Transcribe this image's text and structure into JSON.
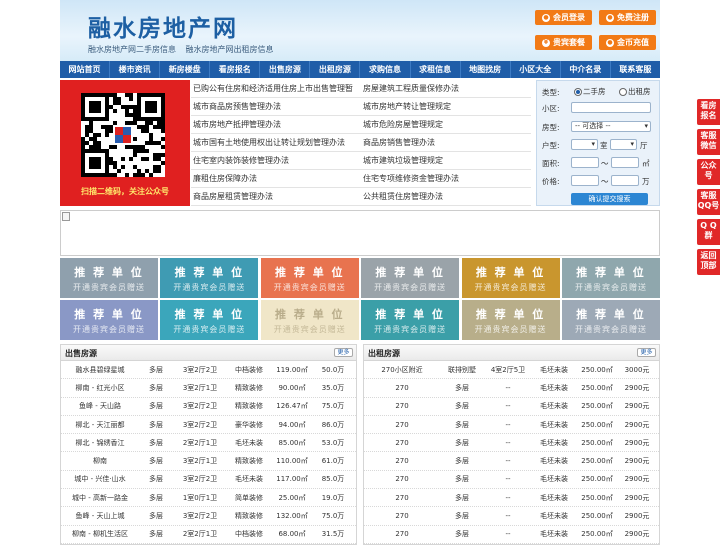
{
  "header": {
    "logo": "融水房地产网",
    "slogans": [
      "融水房地产网二手房信息",
      "融水房地产网出租房信息"
    ],
    "buttons": [
      "会员登录",
      "免费注册",
      "贵宾套餐",
      "金币充值"
    ]
  },
  "nav": [
    "网站首页",
    "楼市资讯",
    "新房楼盘",
    "看房报名",
    "出售房源",
    "出租房源",
    "求购信息",
    "求租信息",
    "地图找房",
    "小区大全",
    "中介名录",
    "联系客服"
  ],
  "qr": {
    "caption": "扫描二维码，关注公众号"
  },
  "news": [
    [
      "已购公有住房和经济适用住房上市出售管理暂",
      "房屋建筑工程质量保修办法"
    ],
    [
      "城市商品房预售管理办法",
      "城市房地产转让管理规定"
    ],
    [
      "城市房地产抵押管理办法",
      "城市危险房屋管理规定"
    ],
    [
      "城市国有土地使用权出让转让规划管理办法",
      "商品房销售管理办法"
    ],
    [
      "住宅室内装饰装修管理办法",
      "城市建筑垃圾管理规定"
    ],
    [
      "廉租住房保障办法",
      "住宅专项维修资金管理办法"
    ],
    [
      "商品房屋租赁管理办法",
      "公共租赁住房管理办法"
    ]
  ],
  "search": {
    "type_label": "类型:",
    "type_options": [
      "二手房",
      "出租房"
    ],
    "community_label": "小区:",
    "house_type_label": "房型:",
    "house_type_value": "-- 可选择 --",
    "layout_label": "户型:",
    "room_unit": "室",
    "hall_unit": "厅",
    "area_label": "面积:",
    "range_sep": "〜",
    "area_unit": "㎡",
    "price_label": "价格:",
    "price_unit": "万",
    "submit": "确认提交搜索"
  },
  "ads": {
    "title": "推 荐 单 位",
    "subtitle": "开通贵宾会员赠送",
    "colors": [
      "#8fa0ad",
      "#3f9bb3",
      "#e8734f",
      "#9aa3a9",
      "#c9962e",
      "#8fa7ad",
      "#8a98c6",
      "#3ba6bb",
      "#f0e6c8",
      "#3b9fa8",
      "#b8ae8a",
      "#9da9b6"
    ]
  },
  "sale": {
    "title": "出售房源",
    "more": "更多",
    "rows": [
      [
        "融水县碧绿星城",
        "多层",
        "3室2厅2卫",
        "中档装修",
        "119.00㎡",
        "50.0万"
      ],
      [
        "柳南 - 红光小区",
        "多层",
        "3室2厅1卫",
        "精致装修",
        "90.00㎡",
        "35.0万"
      ],
      [
        "鱼峰 - 天山路",
        "多层",
        "3室2厅2卫",
        "精致装修",
        "126.47㎡",
        "75.0万"
      ],
      [
        "柳北 - 天江丽都",
        "多层",
        "3室2厅2卫",
        "豪华装修",
        "94.00㎡",
        "86.0万"
      ],
      [
        "柳北 - 锦绣香江",
        "多层",
        "2室2厅1卫",
        "毛坯未装",
        "85.00㎡",
        "53.0万"
      ],
      [
        "柳南",
        "多层",
        "3室2厅1卫",
        "精致装修",
        "110.00㎡",
        "61.0万"
      ],
      [
        "城中 - 兴佳·山水",
        "多层",
        "3室2厅2卫",
        "毛坯未装",
        "117.00㎡",
        "85.0万"
      ],
      [
        "城中 - 高新一路金",
        "多层",
        "1室0厅1卫",
        "简单装修",
        "25.00㎡",
        "19.0万"
      ],
      [
        "鱼峰 - 天山上城",
        "多层",
        "3室2厅2卫",
        "精致装修",
        "132.00㎡",
        "75.0万"
      ],
      [
        "柳南 - 柳机生活区",
        "多层",
        "2室2厅1卫",
        "中档装修",
        "68.00㎡",
        "31.5万"
      ]
    ]
  },
  "rent": {
    "title": "出租房源",
    "more": "更多",
    "rows": [
      [
        "270小区附近",
        "联排别墅",
        "4室2厅5卫",
        "毛坯未装",
        "250.00㎡",
        "3000元"
      ],
      [
        "270",
        "多层",
        "--",
        "毛坯未装",
        "250.00㎡",
        "2900元"
      ],
      [
        "270",
        "多层",
        "--",
        "毛坯未装",
        "250.00㎡",
        "2900元"
      ],
      [
        "270",
        "多层",
        "--",
        "毛坯未装",
        "250.00㎡",
        "2900元"
      ],
      [
        "270",
        "多层",
        "--",
        "毛坯未装",
        "250.00㎡",
        "2900元"
      ],
      [
        "270",
        "多层",
        "--",
        "毛坯未装",
        "250.00㎡",
        "2900元"
      ],
      [
        "270",
        "多层",
        "--",
        "毛坯未装",
        "250.00㎡",
        "2900元"
      ],
      [
        "270",
        "多层",
        "--",
        "毛坯未装",
        "250.00㎡",
        "2900元"
      ],
      [
        "270",
        "多层",
        "--",
        "毛坯未装",
        "250.00㎡",
        "2900元"
      ],
      [
        "270",
        "多层",
        "--",
        "毛坯未装",
        "250.00㎡",
        "2900元"
      ]
    ]
  },
  "side": [
    [
      "看房",
      "报名"
    ],
    [
      "客服",
      "微信"
    ],
    [
      "公众",
      "号"
    ],
    [
      "客服",
      "QQ号"
    ],
    [
      "Q Q",
      "群"
    ],
    [
      "返回",
      "顶部"
    ]
  ]
}
